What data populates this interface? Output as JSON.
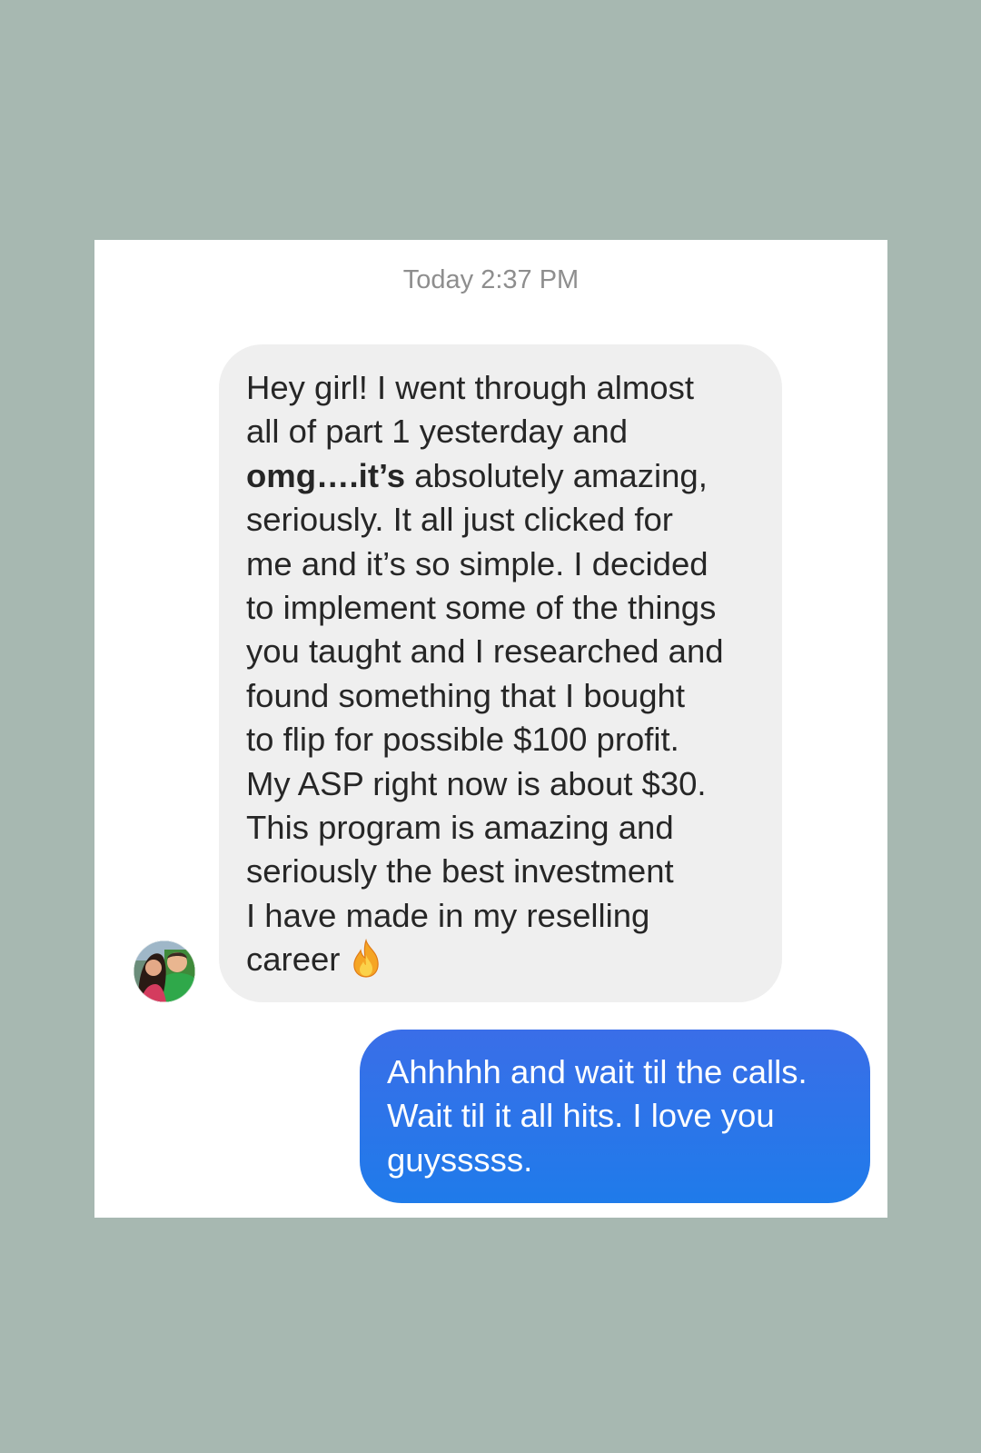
{
  "conversation": {
    "timestamp": "Today 2:37 PM",
    "incoming_message": {
      "lines": [
        "Hey girl! I went through almost",
        "all of part 1 yesterday and",
        "absolutely amazing,",
        "seriously. It all just clicked for",
        "me and it’s so simple. I decided",
        "to implement some of the things",
        "you taught and I researched and",
        "found something that I bought",
        "to flip for possible $100 profit.",
        "My ASP right now is about $30.",
        "This program is amazing and",
        "seriously the best investment",
        "I have made in my reselling",
        "career"
      ],
      "bold_phrase": "omg….it’s",
      "emoji_icon": "fire-icon"
    },
    "outgoing_message": {
      "lines": [
        "Ahhhhh and wait til the calls.",
        "Wait til it all hits. I love you",
        "guysssss."
      ]
    },
    "avatar_icon": "avatar-photo",
    "colors": {
      "background": "#a7b8b1",
      "incoming_bubble": "#efefef",
      "outgoing_bubble_top": "#3a6ee8",
      "outgoing_bubble_bottom": "#1f7bea",
      "timestamp_text": "#8e8e8e"
    }
  }
}
